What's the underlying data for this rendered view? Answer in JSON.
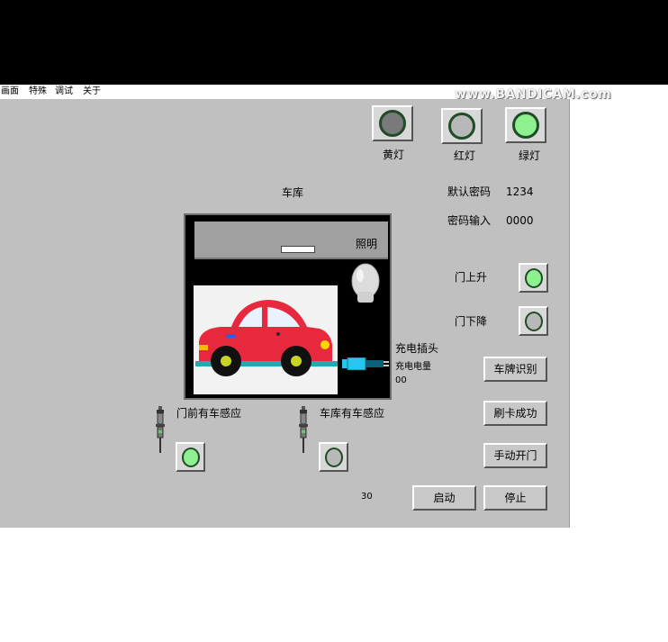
{
  "menu": {
    "items": [
      "画面",
      "特殊",
      "调试",
      "关于"
    ]
  },
  "watermark": "www.BANDICAM.com",
  "lamps": {
    "yellow": {
      "label": "黄灯",
      "fill": "#7a7a7a"
    },
    "red": {
      "label": "红灯",
      "fill": "#b8b8b8"
    },
    "green": {
      "label": "绿灯",
      "fill": "#8ef08e"
    }
  },
  "garage": {
    "title": "车库",
    "lighting_label": "照明"
  },
  "password": {
    "default_label": "默认密码",
    "default_value": "1234",
    "input_label": "密码输入",
    "input_value": "0000"
  },
  "door_indicators": {
    "up": {
      "label": "门上升",
      "fill": "#8ef08e"
    },
    "down": {
      "label": "门下降",
      "fill": "#b8b8b8"
    }
  },
  "charging": {
    "plug_label": "充电插头",
    "level_label": "充电电量",
    "level_value": "00"
  },
  "sensors": {
    "front": {
      "label": "门前有车感应",
      "fill": "#8ef08e"
    },
    "inside": {
      "label": "车库有车感应",
      "fill": "#b8b8b8"
    }
  },
  "buttons": {
    "plate": "车牌识别",
    "card": "刷卡成功",
    "manual": "手动开门",
    "start": "启动",
    "stop": "停止"
  },
  "counter": "30",
  "colors": {
    "panel": "#c0c0c0",
    "car_body": "#e8293d",
    "window": "#e9f3ff",
    "plug": "#26c6f0"
  }
}
